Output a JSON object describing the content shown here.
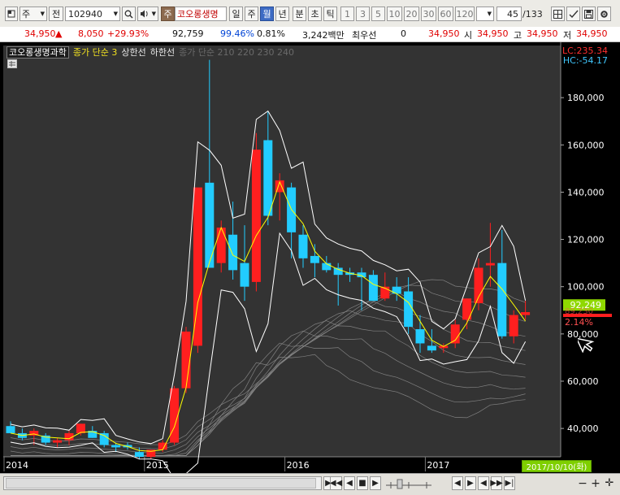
{
  "toolbar": {
    "period_type": "주",
    "prev_label": "전",
    "stock_code": "102940",
    "stock_type": "주",
    "stock_name": "코오롱생명",
    "periods": [
      "일",
      "주",
      "월",
      "년"
    ],
    "selected_period": "월",
    "intervals": [
      "분",
      "초",
      "틱"
    ],
    "numbers": [
      "1",
      "3",
      "5",
      "10",
      "20",
      "30",
      "60",
      "120"
    ],
    "page_current": "45",
    "page_total": "/133"
  },
  "quote": {
    "price": "34,950",
    "arrow": "▲",
    "change": "8,050",
    "change_pct": "+29.93%",
    "volume": "92,759",
    "ratio": "99.46%",
    "turnover": "0.81%",
    "amount": "3,242백만",
    "preferred_label": "최우선",
    "preferred_value": "0",
    "current": "34,950",
    "open_label": "시",
    "open": "34,950",
    "high_label": "고",
    "high": "34,950",
    "low_label": "저",
    "low": "34,950"
  },
  "legend": {
    "name": "코오롱생명과학",
    "ma": "종가 단순 3",
    "upper": "상한선",
    "lower": "하한선",
    "ma_multi": "종가 단순 210 220 230 240"
  },
  "corner": {
    "lc": "LC:235.34",
    "hc": "HC:-54.17",
    "last_price": "92,249",
    "price_mark": "89,230",
    "pct_mark": "2.14%"
  },
  "colors": {
    "up": "#ff1f1f",
    "down": "#22ccff",
    "ma": "#ffff00",
    "band": "#ffffff",
    "bg": "#000000",
    "last_price_bg": "#8fd800"
  },
  "bottom": {
    "date_badge": "2017/10/10(화)"
  },
  "chart_data": {
    "type": "candlestick",
    "x_labels": [
      "2014",
      "2015",
      "2016",
      "2017"
    ],
    "ylim": [
      28000,
      200000
    ],
    "y_ticks": [
      40000,
      60000,
      80000,
      100000,
      120000,
      140000,
      160000,
      180000
    ],
    "y_tick_labels": [
      "40,000",
      "60,000",
      "80,000",
      "100,000",
      "120,000",
      "140,000",
      "160,000",
      "180,000"
    ],
    "candles": [
      {
        "o": 41000,
        "h": 43000,
        "l": 38000,
        "c": 38000
      },
      {
        "o": 38000,
        "h": 40000,
        "l": 35000,
        "c": 36000
      },
      {
        "o": 37000,
        "h": 40000,
        "l": 33000,
        "c": 39000
      },
      {
        "o": 37000,
        "h": 38000,
        "l": 33000,
        "c": 34000
      },
      {
        "o": 34000,
        "h": 36000,
        "l": 32000,
        "c": 35000
      },
      {
        "o": 35000,
        "h": 39000,
        "l": 33000,
        "c": 38000
      },
      {
        "o": 38000,
        "h": 42000,
        "l": 37000,
        "c": 42000
      },
      {
        "o": 39000,
        "h": 41000,
        "l": 36000,
        "c": 36000
      },
      {
        "o": 38000,
        "h": 39000,
        "l": 32000,
        "c": 33000
      },
      {
        "o": 33000,
        "h": 34000,
        "l": 30000,
        "c": 32000
      },
      {
        "o": 33000,
        "h": 34000,
        "l": 31000,
        "c": 32000
      },
      {
        "o": 30000,
        "h": 32000,
        "l": 27000,
        "c": 28000
      },
      {
        "o": 28000,
        "h": 31000,
        "l": 27000,
        "c": 31000
      },
      {
        "o": 31000,
        "h": 35000,
        "l": 30000,
        "c": 34000
      },
      {
        "o": 34000,
        "h": 58000,
        "l": 33000,
        "c": 57000
      },
      {
        "o": 57000,
        "h": 83000,
        "l": 55000,
        "c": 81000
      },
      {
        "o": 75000,
        "h": 130000,
        "l": 72000,
        "c": 142000
      },
      {
        "o": 144000,
        "h": 196000,
        "l": 110000,
        "c": 108000
      },
      {
        "o": 110000,
        "h": 128000,
        "l": 106000,
        "c": 125000
      },
      {
        "o": 122000,
        "h": 136000,
        "l": 103000,
        "c": 107000
      },
      {
        "o": 110000,
        "h": 126000,
        "l": 94000,
        "c": 100000
      },
      {
        "o": 102000,
        "h": 165000,
        "l": 98000,
        "c": 158000
      },
      {
        "o": 162000,
        "h": 174000,
        "l": 126000,
        "c": 130000
      },
      {
        "o": 140000,
        "h": 148000,
        "l": 128000,
        "c": 145000
      },
      {
        "o": 142000,
        "h": 144000,
        "l": 112000,
        "c": 123000
      },
      {
        "o": 122000,
        "h": 126000,
        "l": 108000,
        "c": 112000
      },
      {
        "o": 113000,
        "h": 118000,
        "l": 104000,
        "c": 110000
      },
      {
        "o": 110000,
        "h": 113000,
        "l": 106000,
        "c": 107000
      },
      {
        "o": 108000,
        "h": 110000,
        "l": 92000,
        "c": 105000
      },
      {
        "o": 106000,
        "h": 108000,
        "l": 102000,
        "c": 105000
      },
      {
        "o": 106000,
        "h": 108000,
        "l": 90000,
        "c": 104000
      },
      {
        "o": 105000,
        "h": 107000,
        "l": 94000,
        "c": 94000
      },
      {
        "o": 95000,
        "h": 106000,
        "l": 94000,
        "c": 100000
      },
      {
        "o": 100000,
        "h": 104000,
        "l": 94000,
        "c": 97000
      },
      {
        "o": 98000,
        "h": 104000,
        "l": 80000,
        "c": 83000
      },
      {
        "o": 82000,
        "h": 88000,
        "l": 72000,
        "c": 76000
      },
      {
        "o": 75000,
        "h": 82000,
        "l": 72000,
        "c": 73000
      },
      {
        "o": 74000,
        "h": 76000,
        "l": 72000,
        "c": 75000
      },
      {
        "o": 76000,
        "h": 86000,
        "l": 74000,
        "c": 84000
      },
      {
        "o": 86000,
        "h": 95000,
        "l": 82000,
        "c": 95000
      },
      {
        "o": 93000,
        "h": 112000,
        "l": 90000,
        "c": 108000
      },
      {
        "o": 109000,
        "h": 127000,
        "l": 100000,
        "c": 110000
      },
      {
        "o": 110000,
        "h": 124000,
        "l": 78000,
        "c": 79000
      },
      {
        "o": 79000,
        "h": 90000,
        "l": 76000,
        "c": 88000
      },
      {
        "o": 88000,
        "h": 94000,
        "l": 86000,
        "c": 89230
      }
    ]
  }
}
